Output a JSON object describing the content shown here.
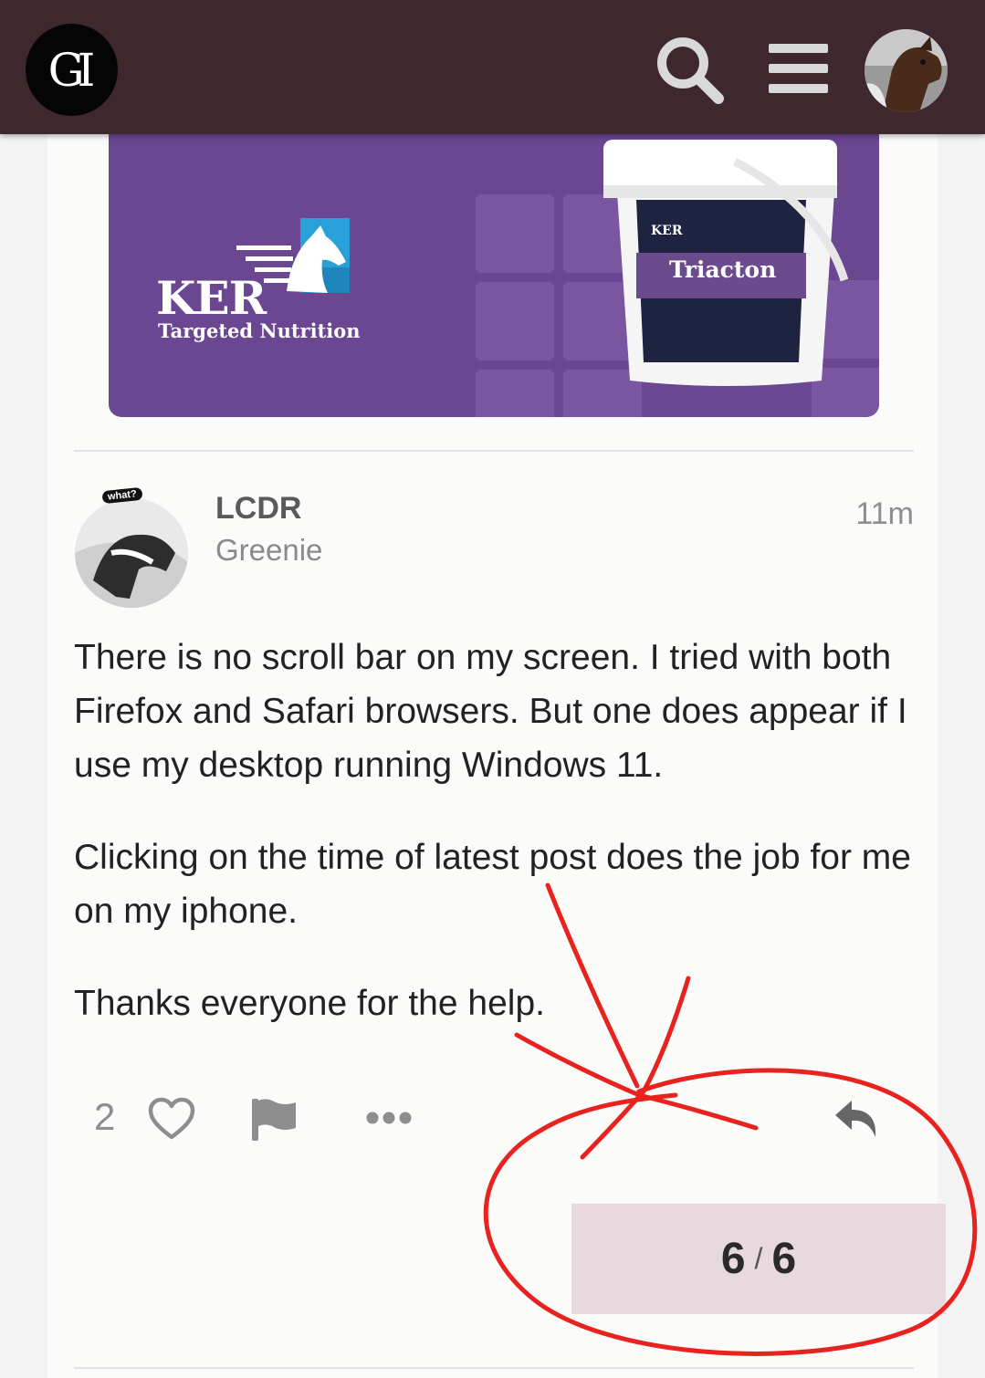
{
  "header": {
    "logo_text": "GI",
    "icons": [
      "search-icon",
      "hamburger-menu-icon",
      "user-avatar"
    ],
    "background": "#3e272d"
  },
  "banner": {
    "brand": "KER",
    "tagline": "Targeted Nutrition",
    "product_brand": "KER",
    "product_name": "Triacton",
    "background": "#6b4691"
  },
  "post": {
    "avatar_badge": "what?",
    "username": "LCDR",
    "user_title": "Greenie",
    "time": "11m",
    "paragraphs": [
      "There is no scroll bar on my screen. I tried with both Firefox and Safari browsers. But one does appear if I use my desktop running Windows 11.",
      "Clicking on the time of latest post does the job for me on my iphone.",
      "Thanks everyone for the help."
    ],
    "actions": {
      "like_count": "2",
      "icons": [
        "heart-icon",
        "flag-icon",
        "more-icon",
        "reply-icon"
      ]
    }
  },
  "progress": {
    "current": "6",
    "separator": "/",
    "total": "6",
    "background": "#e8d9de"
  },
  "annotation_color": "#e8231f"
}
